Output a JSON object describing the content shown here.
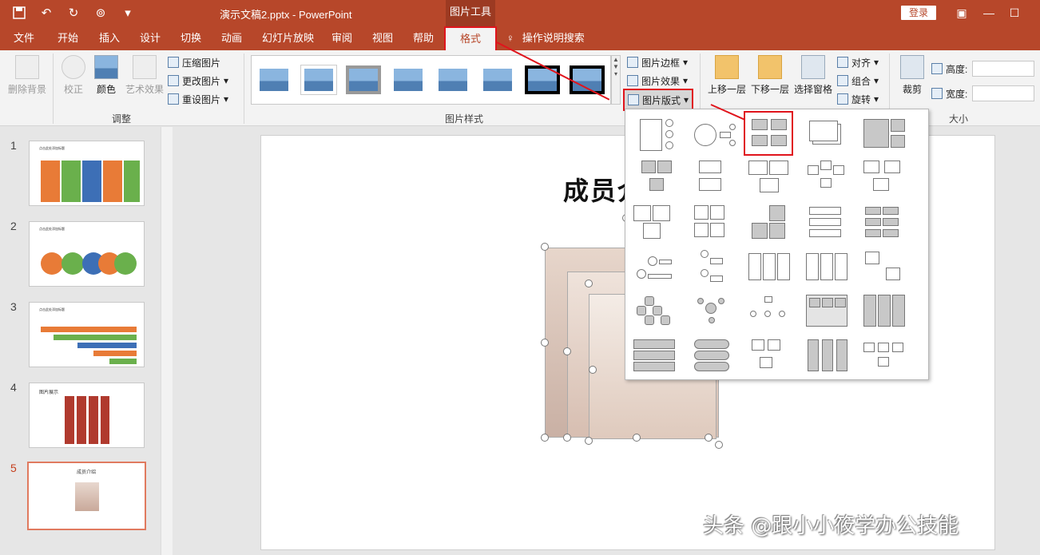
{
  "titlebar": {
    "document_title": "演示文稿2.pptx  -  PowerPoint",
    "context_tab": "图片工具",
    "login": "登录"
  },
  "tabs": [
    "文件",
    "开始",
    "插入",
    "设计",
    "切换",
    "动画",
    "幻灯片放映",
    "审阅",
    "视图",
    "帮助",
    "格式"
  ],
  "active_tab": "格式",
  "tell_me": "操作说明搜索",
  "ribbon": {
    "adjust": {
      "remove_bg": "删除背景",
      "correct": "校正",
      "color": "颜色",
      "artistic": "艺术效果",
      "compress": "压缩图片",
      "change": "更改图片",
      "reset": "重设图片",
      "label": "调整"
    },
    "styles": {
      "label": "图片样式",
      "border": "图片边框",
      "effects": "图片效果",
      "layout": "图片版式"
    },
    "arrange": {
      "bring_forward": "上移一层",
      "send_backward": "下移一层",
      "selection_pane": "选择窗格",
      "align": "对齐",
      "group": "组合",
      "rotate": "旋转"
    },
    "size": {
      "crop": "裁剪",
      "height_label": "高度:",
      "width_label": "宽度:",
      "label": "大小"
    }
  },
  "slides": [
    {
      "num": "1",
      "title": "点击此处添加标题"
    },
    {
      "num": "2",
      "title": "点击此处添加标题"
    },
    {
      "num": "3",
      "title": "点击此处添加标题"
    },
    {
      "num": "4",
      "title": "图片展示"
    },
    {
      "num": "5",
      "title": "成员介绍"
    }
  ],
  "active_slide": "5",
  "slide_title": "成员介绍",
  "watermark": "头条 @跟小小筱学办公技能",
  "colors": {
    "accent": "#b7472a",
    "highlight": "#e0141c"
  }
}
